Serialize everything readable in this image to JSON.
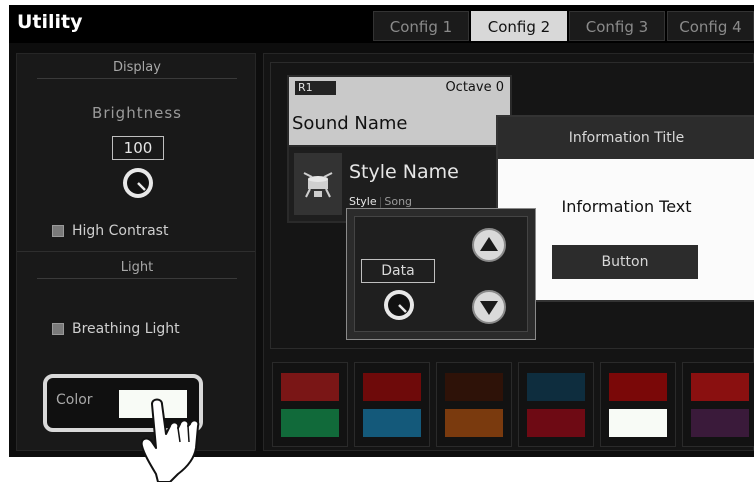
{
  "app": {
    "title": "Utility"
  },
  "tabs": [
    {
      "label": "Config 1",
      "active": false
    },
    {
      "label": "Config 2",
      "active": true
    },
    {
      "label": "Config 3",
      "active": false
    },
    {
      "label": "Config 4",
      "active": false
    }
  ],
  "display": {
    "section_title": "Display",
    "brightness_label": "Brightness",
    "brightness_value": "100",
    "high_contrast_label": "High Contrast"
  },
  "light": {
    "section_title": "Light",
    "breathing_light_label": "Breathing Light",
    "color_label": "Color",
    "selected_color": "#f8fbf6"
  },
  "sound": {
    "register_badge": "R1",
    "octave_label": "Octave 0",
    "sound_name": "Sound Name",
    "style_name": "Style Name",
    "style_tab": "Style",
    "song_tab": "Song"
  },
  "data_dialog": {
    "label": "Data"
  },
  "info_dialog": {
    "title": "Information Title",
    "text": "Information Text",
    "button_label": "Button"
  },
  "palette": [
    {
      "top": "#7a1616",
      "bottom": "#116a3a"
    },
    {
      "top": "#6e0a0a",
      "bottom": "#14597a"
    },
    {
      "top": "#2e1208",
      "bottom": "#7a3a0e"
    },
    {
      "top": "#0e2d3e",
      "bottom": "#6e0a14"
    },
    {
      "top": "#7a0808",
      "bottom": "#f8fbf6"
    },
    {
      "top": "#8a1010",
      "bottom": "#3a1a3a"
    }
  ],
  "icons": [
    "knob-icon",
    "style-drum-icon",
    "arrow-up-icon",
    "arrow-down-icon",
    "hand-pointer-icon"
  ],
  "colors": {
    "background": "#0d0d0d",
    "panel": "#191919",
    "highlight": "#d9d9d9"
  }
}
